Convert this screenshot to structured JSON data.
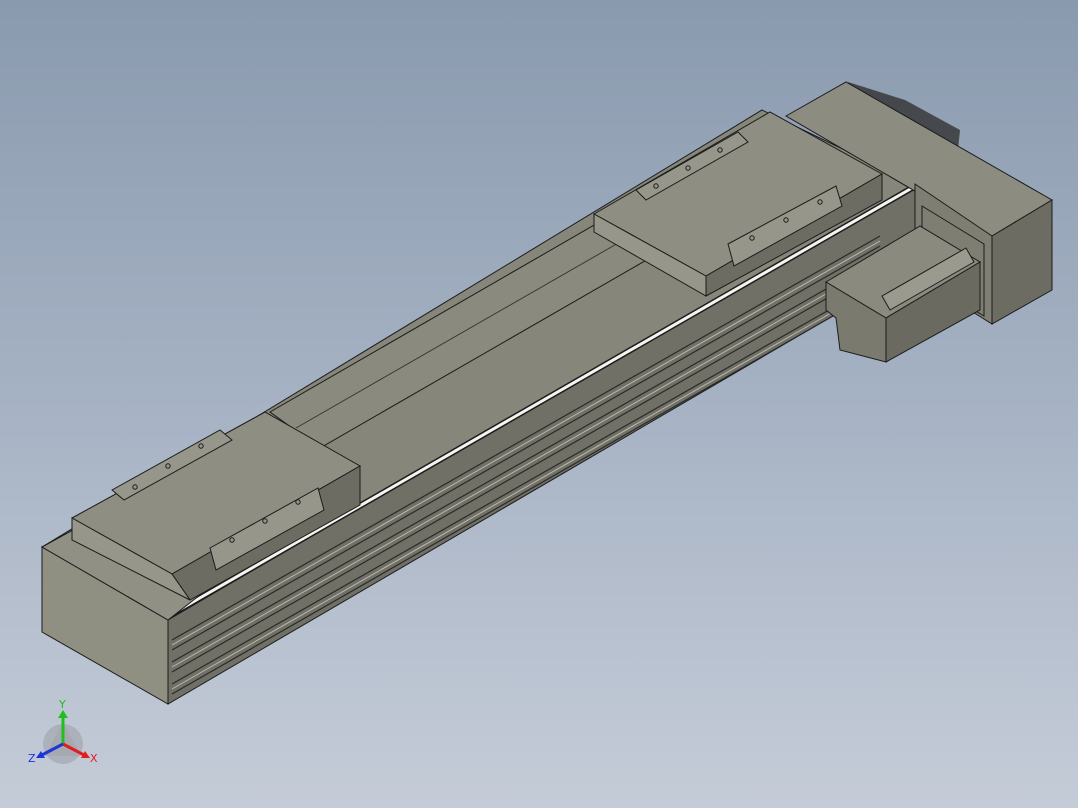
{
  "viewport": {
    "background_top": "#8a9aae",
    "background_bottom": "#c5ccd8"
  },
  "model": {
    "body_colors": {
      "top": "#8c8c80",
      "side": "#7b7b6f",
      "front": "#9b9b8e",
      "dark": "#5f5f55",
      "edge": "#1c1c1c",
      "rail": "#f4f4f0"
    }
  },
  "triad": {
    "y_label": "Y",
    "x_label": "X",
    "z_label": "Z",
    "y_color": "#1fbf1f",
    "x_color": "#e01e1e",
    "z_color": "#1c37d6"
  }
}
